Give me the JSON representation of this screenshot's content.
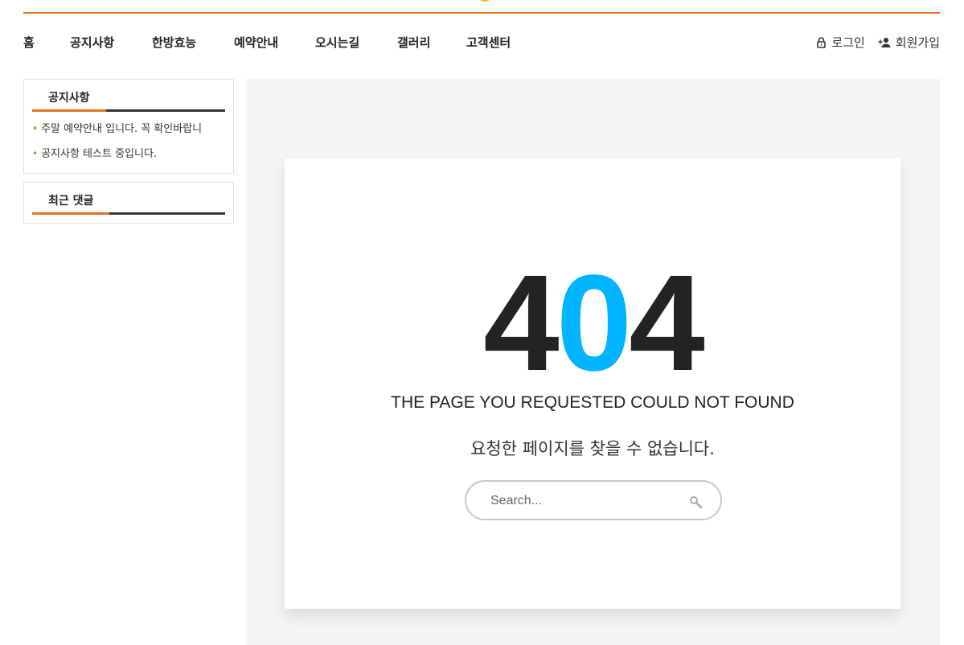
{
  "header": {
    "nav": [
      {
        "label": "홈"
      },
      {
        "label": "공지사항"
      },
      {
        "label": "한방효능"
      },
      {
        "label": "예약안내"
      },
      {
        "label": "오시는길"
      },
      {
        "label": "갤러리"
      },
      {
        "label": "고객센터"
      }
    ],
    "login_label": "로그인",
    "signup_label": "회원가입",
    "icons": {
      "login": "lock-icon",
      "signup": "user-plus-icon"
    }
  },
  "sidebar": {
    "notice": {
      "title": "공지사항",
      "items": [
        "주말 예약안내 입니다. 꼭 확인바랍니",
        "공지사항 테스트 중입니다."
      ]
    },
    "comments": {
      "title": "최근 댓글"
    }
  },
  "error": {
    "digit1": "4",
    "digit2": "0",
    "digit3": "4",
    "message_en": "THE PAGE YOU REQUESTED COULD NOT FOUND",
    "message_ko": "요청한 페이지를 찾을 수 없습니다."
  },
  "search": {
    "placeholder": "Search...",
    "icon": "search-icon"
  },
  "colors": {
    "accent_orange": "#e8731f",
    "accent_blue": "#00b4ff",
    "dark": "#232323",
    "content_bg": "#f5f5f5"
  }
}
